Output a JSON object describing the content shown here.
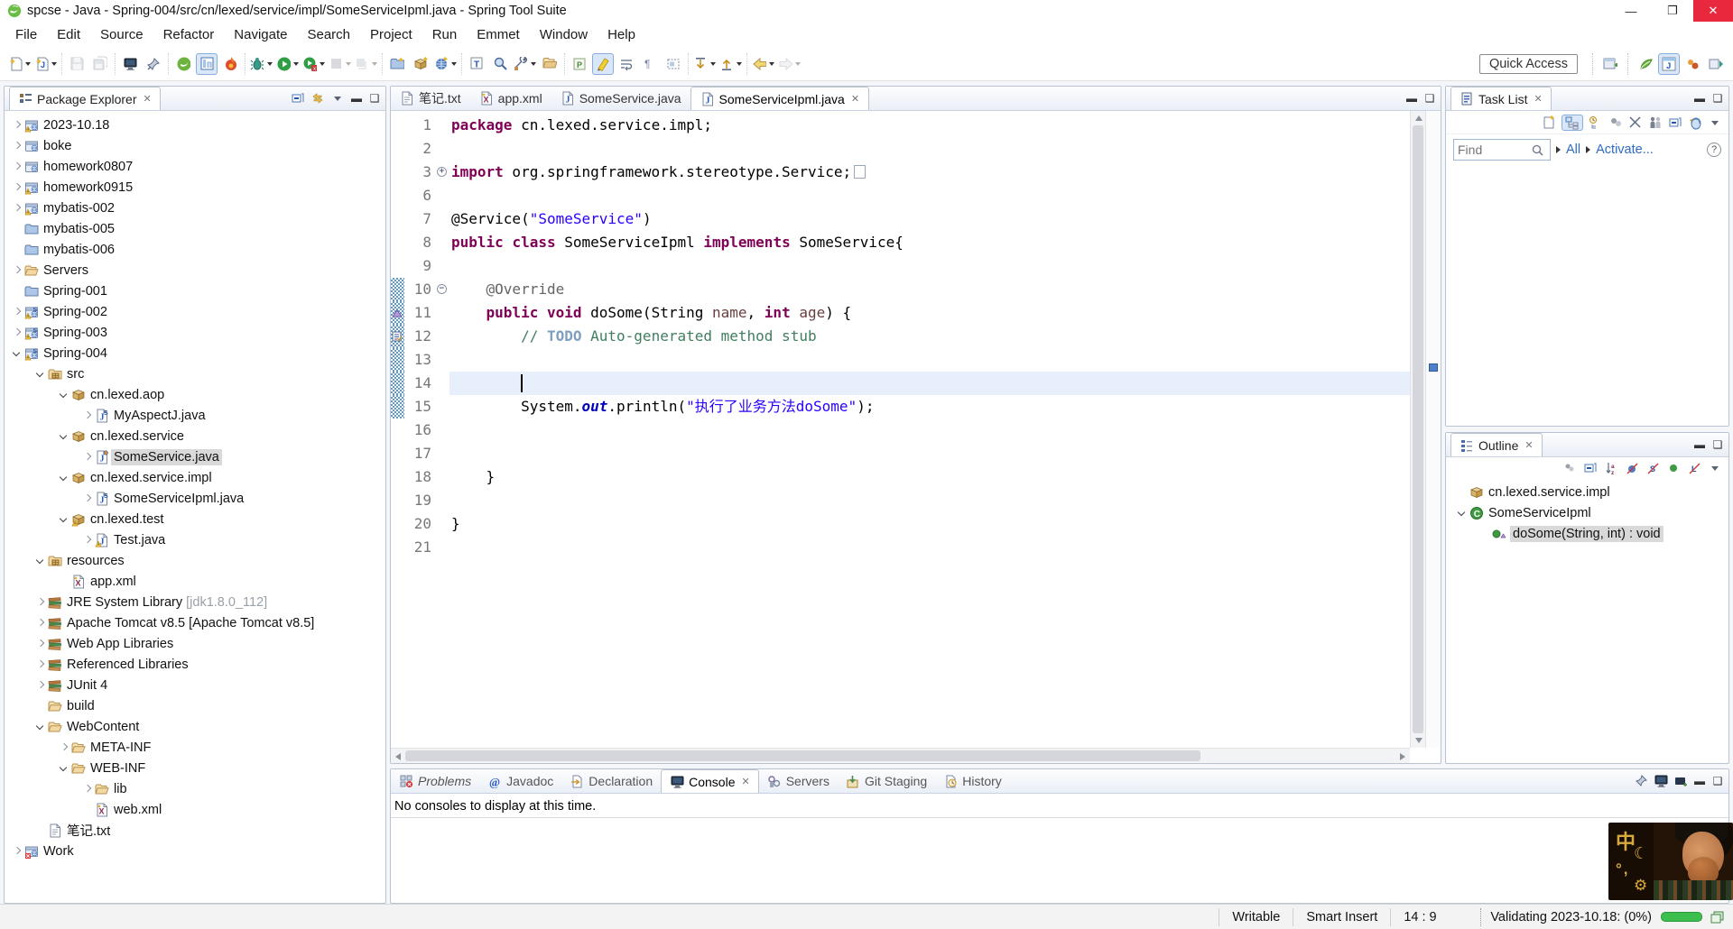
{
  "window": {
    "title": "spcse - Java - Spring-004/src/cn/lexed/service/impl/SomeServiceIpml.java - Spring Tool Suite",
    "controls": {
      "minimize": "—",
      "maximize": "❐",
      "close": "✕"
    }
  },
  "menu": {
    "items": [
      "File",
      "Edit",
      "Source",
      "Refactor",
      "Navigate",
      "Search",
      "Project",
      "Run",
      "Emmet",
      "Window",
      "Help"
    ]
  },
  "toolbar": {
    "quick_access": "Quick Access",
    "groups": [
      [
        {
          "n": "new-wizard",
          "d": 1
        },
        {
          "n": "new-java-element",
          "d": 1
        }
      ],
      [
        {
          "n": "save",
          "dis": 1
        },
        {
          "n": "save-all",
          "dis": 1
        }
      ],
      [
        {
          "n": "open-console-view"
        },
        {
          "n": "pin-editor"
        }
      ],
      [
        {
          "n": "spring-boot"
        },
        {
          "n": "boot-dashboard",
          "s": 1
        },
        {
          "n": "spring-devtools"
        }
      ],
      [
        {
          "n": "debug",
          "d": 1
        },
        {
          "n": "run",
          "d": 1
        },
        {
          "n": "coverage",
          "d": 1
        },
        {
          "n": "stop",
          "d": 1,
          "dis": 1
        },
        {
          "n": "run-history",
          "d": 1,
          "dis": 1
        }
      ],
      [
        {
          "n": "new-java-project"
        },
        {
          "n": "new-package"
        },
        {
          "n": "new-web-project",
          "d": 1
        }
      ],
      [
        {
          "n": "open-type"
        },
        {
          "n": "search"
        },
        {
          "n": "external-tools",
          "d": 1
        },
        {
          "n": "open-resource"
        }
      ],
      [
        {
          "n": "mark-occurrences"
        },
        {
          "n": "highlight",
          "s": 1
        },
        {
          "n": "word-wrap"
        },
        {
          "n": "show-whitespace"
        },
        {
          "n": "block-selection"
        }
      ],
      [
        {
          "n": "next-annotation",
          "d": 1
        },
        {
          "n": "prev-annotation",
          "d": 1
        }
      ],
      [
        {
          "n": "back",
          "d": 1
        },
        {
          "n": "forward",
          "d": 1,
          "dis": 1
        }
      ]
    ],
    "perspectives": [
      {
        "n": "open-perspective"
      },
      {
        "n": "spring-perspective"
      },
      {
        "n": "java-perspective",
        "s": 1
      },
      {
        "n": "resource-perspective"
      },
      {
        "n": "debug-perspective"
      }
    ]
  },
  "explorer": {
    "title": "Package Explorer",
    "items": [
      {
        "i": 0,
        "a": "c",
        "ic": "java-project-warning",
        "l": "2023-10.18"
      },
      {
        "i": 0,
        "a": "c",
        "ic": "java-project",
        "l": "boke"
      },
      {
        "i": 0,
        "a": "c",
        "ic": "java-project",
        "l": "homework0807"
      },
      {
        "i": 0,
        "a": "c",
        "ic": "java-project-warning",
        "l": "homework0915"
      },
      {
        "i": 0,
        "a": "c",
        "ic": "java-project-warning",
        "l": "mybatis-002"
      },
      {
        "i": 0,
        "a": "",
        "ic": "folder",
        "l": "mybatis-005"
      },
      {
        "i": 0,
        "a": "",
        "ic": "folder",
        "l": "mybatis-006"
      },
      {
        "i": 0,
        "a": "c",
        "ic": "folder-open",
        "l": "Servers"
      },
      {
        "i": 0,
        "a": "",
        "ic": "folder",
        "l": "Spring-001"
      },
      {
        "i": 0,
        "a": "c",
        "ic": "web-project-warning",
        "l": "Spring-002"
      },
      {
        "i": 0,
        "a": "c",
        "ic": "web-project-warning",
        "l": "Spring-003"
      },
      {
        "i": 0,
        "a": "e",
        "ic": "web-project-warning",
        "l": "Spring-004"
      },
      {
        "i": 1,
        "a": "e",
        "ic": "src-folder",
        "l": "src"
      },
      {
        "i": 2,
        "a": "e",
        "ic": "package",
        "l": "cn.lexed.aop"
      },
      {
        "i": 3,
        "a": "c",
        "ic": "java-file-s",
        "l": "MyAspectJ.java"
      },
      {
        "i": 2,
        "a": "e",
        "ic": "package",
        "l": "cn.lexed.service"
      },
      {
        "i": 3,
        "a": "c",
        "ic": "java-file-badge",
        "l": "SomeService.java",
        "sel": true
      },
      {
        "i": 2,
        "a": "e",
        "ic": "package",
        "l": "cn.lexed.service.impl"
      },
      {
        "i": 3,
        "a": "c",
        "ic": "java-file-s",
        "l": "SomeServiceIpml.java"
      },
      {
        "i": 2,
        "a": "e",
        "ic": "package-warning",
        "l": "cn.lexed.test"
      },
      {
        "i": 3,
        "a": "c",
        "ic": "java-file-warning",
        "l": "Test.java"
      },
      {
        "i": 1,
        "a": "e",
        "ic": "src-folder",
        "l": "resources"
      },
      {
        "i": 2,
        "a": "",
        "ic": "xml-file",
        "l": "app.xml"
      },
      {
        "i": 1,
        "a": "c",
        "ic": "library",
        "l": "JRE System Library",
        "sfx": "[jdk1.8.0_112]"
      },
      {
        "i": 1,
        "a": "c",
        "ic": "library",
        "l": "Apache Tomcat v8.5 [Apache Tomcat v8.5]"
      },
      {
        "i": 1,
        "a": "c",
        "ic": "library",
        "l": "Web App Libraries"
      },
      {
        "i": 1,
        "a": "c",
        "ic": "library",
        "l": "Referenced Libraries"
      },
      {
        "i": 1,
        "a": "c",
        "ic": "library",
        "l": "JUnit 4"
      },
      {
        "i": 1,
        "a": "",
        "ic": "folder-open",
        "l": "build"
      },
      {
        "i": 1,
        "a": "e",
        "ic": "folder-open",
        "l": "WebContent"
      },
      {
        "i": 2,
        "a": "c",
        "ic": "folder-open",
        "l": "META-INF"
      },
      {
        "i": 2,
        "a": "e",
        "ic": "folder-open",
        "l": "WEB-INF"
      },
      {
        "i": 3,
        "a": "c",
        "ic": "folder-open",
        "l": "lib"
      },
      {
        "i": 3,
        "a": "",
        "ic": "xml-file",
        "l": "web.xml"
      },
      {
        "i": 1,
        "a": "",
        "ic": "text-file",
        "l": "笔记.txt"
      },
      {
        "i": 0,
        "a": "c",
        "ic": "java-project-error",
        "l": "Work"
      }
    ]
  },
  "editor": {
    "tabs": [
      {
        "ic": "text-file",
        "l": "笔记.txt"
      },
      {
        "ic": "xml-file",
        "l": "app.xml"
      },
      {
        "ic": "java-file",
        "l": "SomeService.java"
      },
      {
        "ic": "java-file",
        "l": "SomeServiceIpml.java",
        "active": true
      }
    ],
    "lines": [
      {
        "n": "1",
        "segs": [
          [
            "kw",
            "package"
          ],
          [
            "pl",
            " cn.lexed.service.impl;"
          ]
        ]
      },
      {
        "n": "2",
        "segs": []
      },
      {
        "n": "3",
        "fold": "plus",
        "segs": [
          [
            "kw",
            "import"
          ],
          [
            "pl",
            " org.springframework.stereotype.Service;"
          ],
          [
            "box",
            ""
          ]
        ]
      },
      {
        "n": "6",
        "segs": []
      },
      {
        "n": "7",
        "segs": [
          [
            "pl",
            "@Service("
          ],
          [
            "str",
            "\"SomeService\""
          ],
          [
            "pl",
            ")"
          ]
        ]
      },
      {
        "n": "8",
        "segs": [
          [
            "kw",
            "public"
          ],
          [
            "pl",
            " "
          ],
          [
            "kw",
            "class"
          ],
          [
            "pl",
            " SomeServiceIpml "
          ],
          [
            "kw",
            "implements"
          ],
          [
            "pl",
            " SomeService{"
          ]
        ]
      },
      {
        "n": "9",
        "segs": []
      },
      {
        "n": "10",
        "fold": "minus",
        "bar": true,
        "segs": [
          [
            "pl",
            "    "
          ],
          [
            "ann",
            "@Override"
          ]
        ]
      },
      {
        "n": "11",
        "bar": true,
        "marker": "override",
        "segs": [
          [
            "pl",
            "    "
          ],
          [
            "kw",
            "public"
          ],
          [
            "pl",
            " "
          ],
          [
            "kw",
            "void"
          ],
          [
            "pl",
            " doSome(String "
          ],
          [
            "param",
            "name"
          ],
          [
            "pl",
            ", "
          ],
          [
            "kw",
            "int"
          ],
          [
            "pl",
            " "
          ],
          [
            "param",
            "age"
          ],
          [
            "pl",
            ") {"
          ]
        ]
      },
      {
        "n": "12",
        "bar": true,
        "marker": "task",
        "segs": [
          [
            "pl",
            "        "
          ],
          [
            "cmt",
            "// "
          ],
          [
            "todo",
            "TODO"
          ],
          [
            "cmt",
            " Auto-generated method stub"
          ]
        ]
      },
      {
        "n": "13",
        "bar": true,
        "segs": []
      },
      {
        "n": "14",
        "bar": true,
        "current": true,
        "caret": 8,
        "segs": []
      },
      {
        "n": "15",
        "bar": true,
        "segs": [
          [
            "pl",
            "        System."
          ],
          [
            "field",
            "out"
          ],
          [
            "pl",
            ".println("
          ],
          [
            "str",
            "\"执行了业务方法doSome\""
          ],
          [
            "pl",
            ");"
          ]
        ]
      },
      {
        "n": "16",
        "segs": []
      },
      {
        "n": "17",
        "segs": []
      },
      {
        "n": "18",
        "segs": [
          [
            "pl",
            "    }"
          ]
        ]
      },
      {
        "n": "19",
        "segs": []
      },
      {
        "n": "20",
        "segs": [
          [
            "pl",
            "}"
          ]
        ]
      },
      {
        "n": "21",
        "segs": []
      }
    ]
  },
  "tasklist": {
    "title": "Task List",
    "find_placeholder": "Find",
    "links": [
      "All",
      "Activate..."
    ],
    "help": "?"
  },
  "outline": {
    "title": "Outline",
    "items": [
      {
        "i": 0,
        "a": "",
        "ic": "package",
        "l": "cn.lexed.service.impl"
      },
      {
        "i": 0,
        "a": "e",
        "ic": "class",
        "l": "SomeServiceIpml"
      },
      {
        "i": 1,
        "a": "",
        "ic": "method-override",
        "l": "doSome(String, int) : void",
        "sel": true
      }
    ]
  },
  "console": {
    "tabs": [
      {
        "ic": "problems",
        "l": "Problems",
        "ital": true
      },
      {
        "ic": "javadoc",
        "l": "Javadoc"
      },
      {
        "ic": "declaration",
        "l": "Declaration"
      },
      {
        "ic": "console",
        "l": "Console",
        "active": true
      },
      {
        "ic": "servers",
        "l": "Servers"
      },
      {
        "ic": "git",
        "l": "Git Staging"
      },
      {
        "ic": "history",
        "l": "History"
      }
    ],
    "message": "No consoles to display at this time."
  },
  "statusbar": {
    "writable": "Writable",
    "insert_mode": "Smart Insert",
    "position": "14 : 9",
    "progress_label": "Validating 2023-10.18: (0%)"
  },
  "ime": {
    "chinese": "中",
    "moon": "☾",
    "punct": "°,",
    "gear": "⚙"
  },
  "colors": {
    "keyword": "#7f0055",
    "string": "#2a00ff",
    "comment": "#3f7f5f",
    "accent_selection": "#d9e7f8",
    "close_button": "#e8283c",
    "progress_green": "#3cbf4e"
  }
}
